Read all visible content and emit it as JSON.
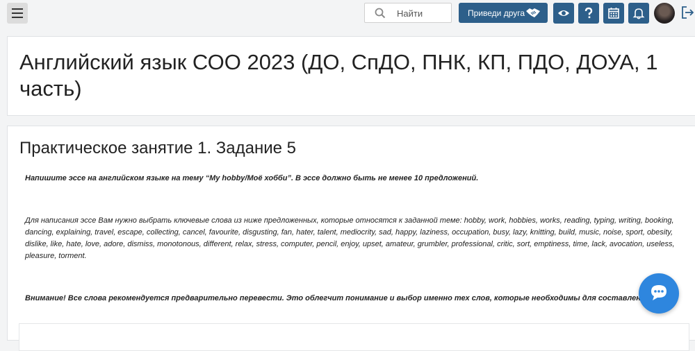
{
  "header": {
    "search_placeholder": "Найти",
    "invite_label": "Приведи друга",
    "icons": [
      "menu-icon",
      "search-icon",
      "handshake-icon",
      "eye-icon",
      "help-icon",
      "calendar-icon",
      "bell-icon",
      "avatar",
      "logout-icon"
    ]
  },
  "course": {
    "title": "Английский язык СОО 2023 (ДО, СпДО, ПНК, КП, ПДО, ДОУА, 1 часть)"
  },
  "assignment": {
    "title": "Практическое занятие 1. Задание 5",
    "task": "Напишите эссе на английском языке на тему “My hobby/Моё хобби”. В эссе должно быть не менее 10 предложений.",
    "instructions": "Для написания эссе Вам нужно выбрать ключевые слова из ниже предложенных, которые относятся к заданной теме: hobby, work, hobbies, works, reading, typing, writing, booking, dancing, explaining, travel, escape, collecting, cancel, favourite, disgusting, fan, hater, talent, mediocrity, sad, happy, laziness, occupation, busy, lazy, knitting, build, music, noise, sport, obesity, dislike, like, hate, love, adore, dismiss, monotonous, different, relax, stress, computer, pencil, enjoy, upset, amateur, grumbler, professional, critic, sort, emptiness, time, lack, avocation, useless, pleasure, torment.",
    "note": "Внимание! Все слова рекомендуется предварительно перевести. Это облегчит понимание и выбор именно тех слов, которые необходимы для составления эссе."
  },
  "colors": {
    "primary": "#2d5f8a",
    "chat": "#2e86de",
    "background": "#f3f4f5"
  }
}
